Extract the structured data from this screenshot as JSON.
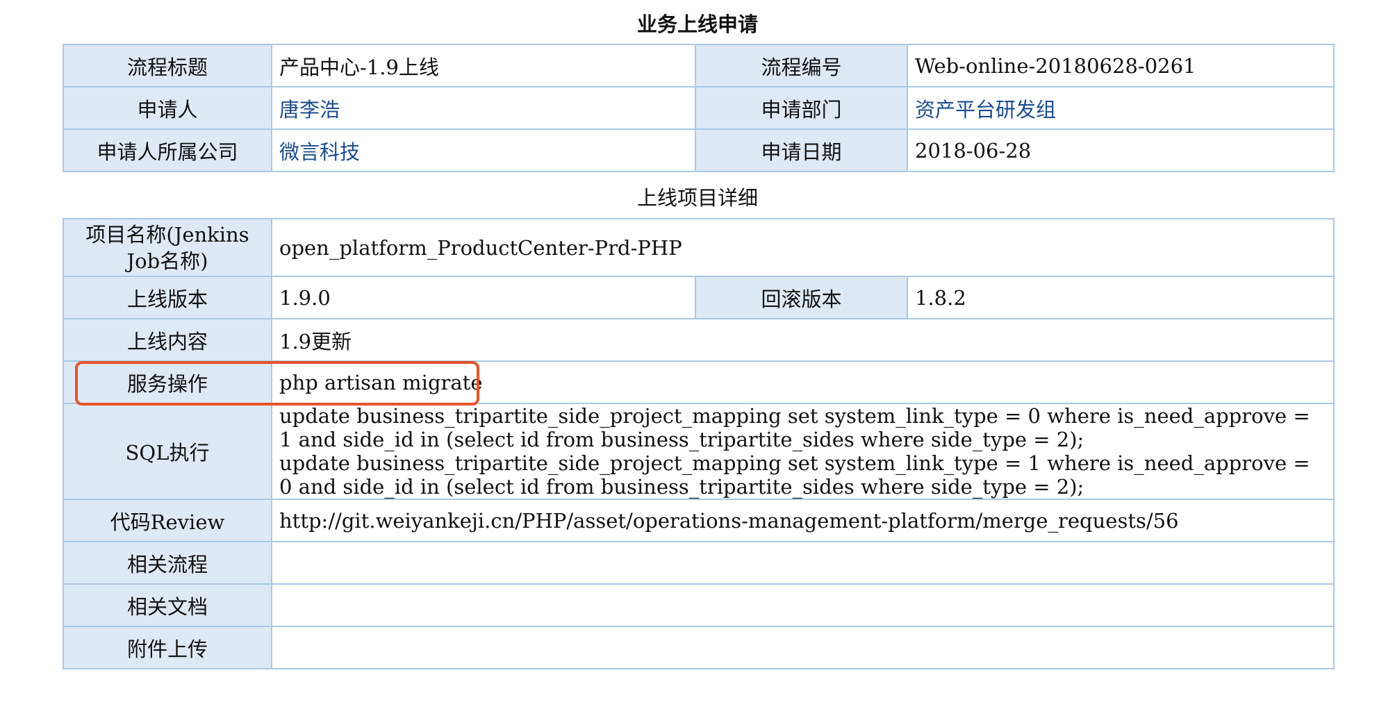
{
  "header": {
    "title": "业务上线申请"
  },
  "info": {
    "process_title_label": "流程标题",
    "process_title_value": "产品中心-1.9上线",
    "process_no_label": "流程编号",
    "process_no_value": "Web-online-20180628-0261",
    "applicant_label": "申请人",
    "applicant_value": "唐李浩",
    "dept_label": "申请部门",
    "dept_value": "资产平台研发组",
    "company_label": "申请人所属公司",
    "company_value": "微言科技",
    "date_label": "申请日期",
    "date_value": "2018-06-28"
  },
  "details": {
    "section_title": "上线项目详细",
    "project_name_label": "项目名称(Jenkins Job名称)",
    "project_name_value": "open_platform_ProductCenter-Prd-PHP",
    "version_label": "上线版本",
    "version_value": "1.9.0",
    "rollback_label": "回滚版本",
    "rollback_value": "1.8.2",
    "content_label": "上线内容",
    "content_value": "1.9更新",
    "service_op_label": "服务操作",
    "service_op_value": "php artisan migrate",
    "sql_label": "SQL执行",
    "sql_line1": "update business_tripartite_side_project_mapping set system_link_type = 0 where is_need_approve = 1 and side_id in (select id from business_tripartite_sides where side_type = 2);",
    "sql_line2": "update business_tripartite_side_project_mapping set system_link_type = 1 where is_need_approve = 0 and side_id in (select id from business_tripartite_sides where side_type = 2);",
    "review_label": "代码Review",
    "review_value": "http://git.weiyankeji.cn/PHP/asset/operations-management-platform/merge_requests/56",
    "related_flow_label": "相关流程",
    "related_flow_value": "",
    "related_doc_label": "相关文档",
    "related_doc_value": "",
    "attachment_label": "附件上传",
    "attachment_value": ""
  },
  "colors": {
    "label_bg": "#dde9f5",
    "border": "#aac8e4",
    "link": "#1a4c8c",
    "highlight": "#e8532b"
  }
}
